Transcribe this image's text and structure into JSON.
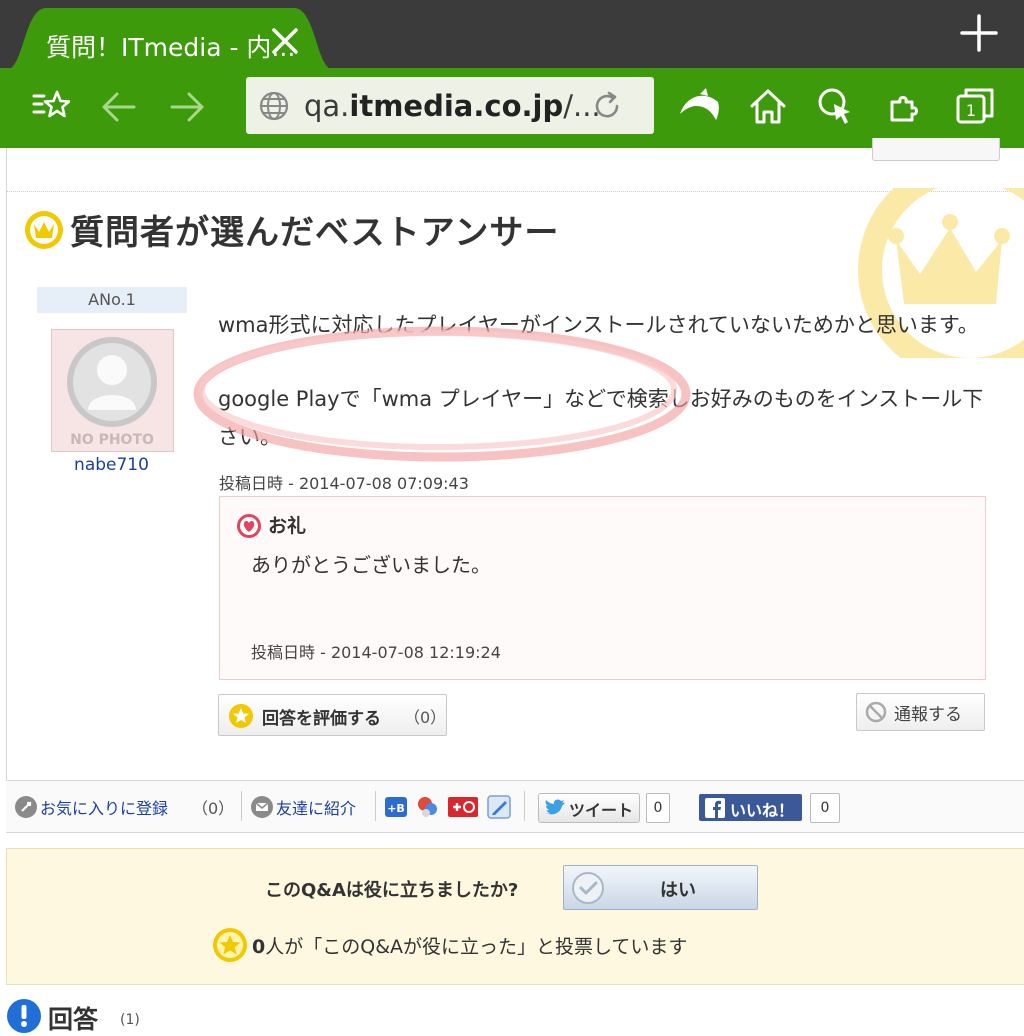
{
  "browser": {
    "tab_title": "質問！ITmedia - 内...",
    "url_prefix": "qa.",
    "url_domain": "itmedia.co.jp",
    "url_suffix": "/...",
    "tab_count": "1",
    "accent_color": "#3c9a0b"
  },
  "best_answer": {
    "heading": "質問者が選んだベストアンサー",
    "answer_no": "ANo.1",
    "avatar_text": "NO PHOTO",
    "author": "nabe710",
    "paragraph1": "wma形式に対応したプレイヤーがインストールされていないためかと思います。",
    "paragraph2": "google Playで「wma プレイヤー」などで検索しお好みのものをインストール下さい。",
    "posted": "投稿日時 - 2014-07-08 07:09:43"
  },
  "thanks": {
    "label": "お礼",
    "message": "ありがとうございました。",
    "posted": "投稿日時 - 2014-07-08 12:19:24"
  },
  "actions": {
    "rate_label": "回答を評価する",
    "rate_count": "（0）",
    "report_label": "通報する"
  },
  "share": {
    "favorite_label": "お気に入りに登録",
    "favorite_count": "（0）",
    "friend_label": "友達に紹介",
    "tweet_label": "ツイート",
    "tweet_count": "0",
    "like_label": "いいね！",
    "like_count": "0"
  },
  "helpful": {
    "question": "このQ&Aは役に立ちましたか?",
    "yes_label": "はい",
    "count_value": "0",
    "count_text": "人が「このQ&Aが役に立った」と投票しています"
  },
  "answers": {
    "heading": "回答",
    "count": "(1)"
  }
}
